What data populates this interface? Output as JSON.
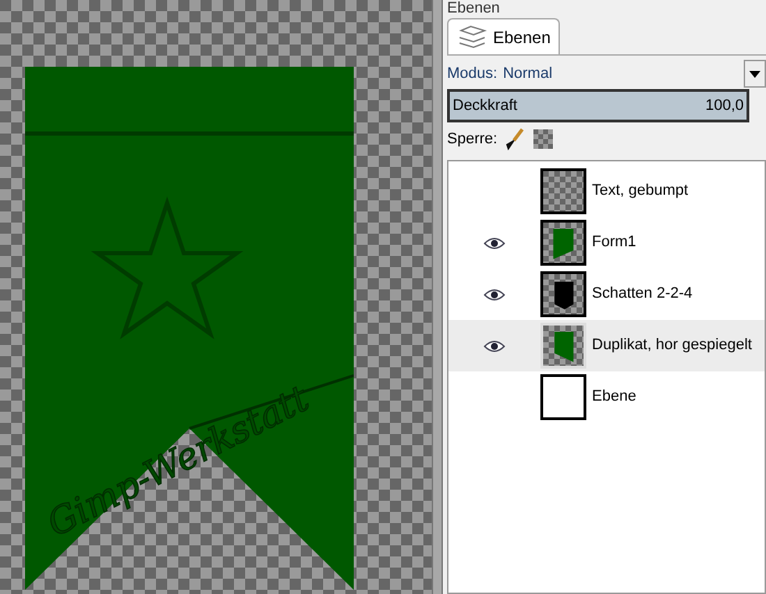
{
  "canvas": {
    "emboss_text": "Gimp-Werkstatt"
  },
  "panel_title": "Ebenen",
  "tabs": [
    {
      "label": "Ebenen",
      "selected": true
    }
  ],
  "mode": {
    "label": "Modus:",
    "value": "Normal"
  },
  "opacity": {
    "label": "Deckkraft",
    "value": "100,0",
    "level": 1
  },
  "lock": {
    "label": "Sperre:"
  },
  "layers": [
    {
      "name": "Text, gebumpt",
      "visible": false,
      "selected": false,
      "kind": "empty"
    },
    {
      "name": "Form1",
      "visible": true,
      "selected": false,
      "kind": "green"
    },
    {
      "name": "Schatten 2-2-4",
      "visible": true,
      "selected": false,
      "kind": "black"
    },
    {
      "name": "Duplikat, hor gespiegelt",
      "visible": true,
      "selected": true,
      "kind": "green-mirror"
    },
    {
      "name": "Ebene",
      "visible": false,
      "selected": false,
      "kind": "white"
    }
  ]
}
